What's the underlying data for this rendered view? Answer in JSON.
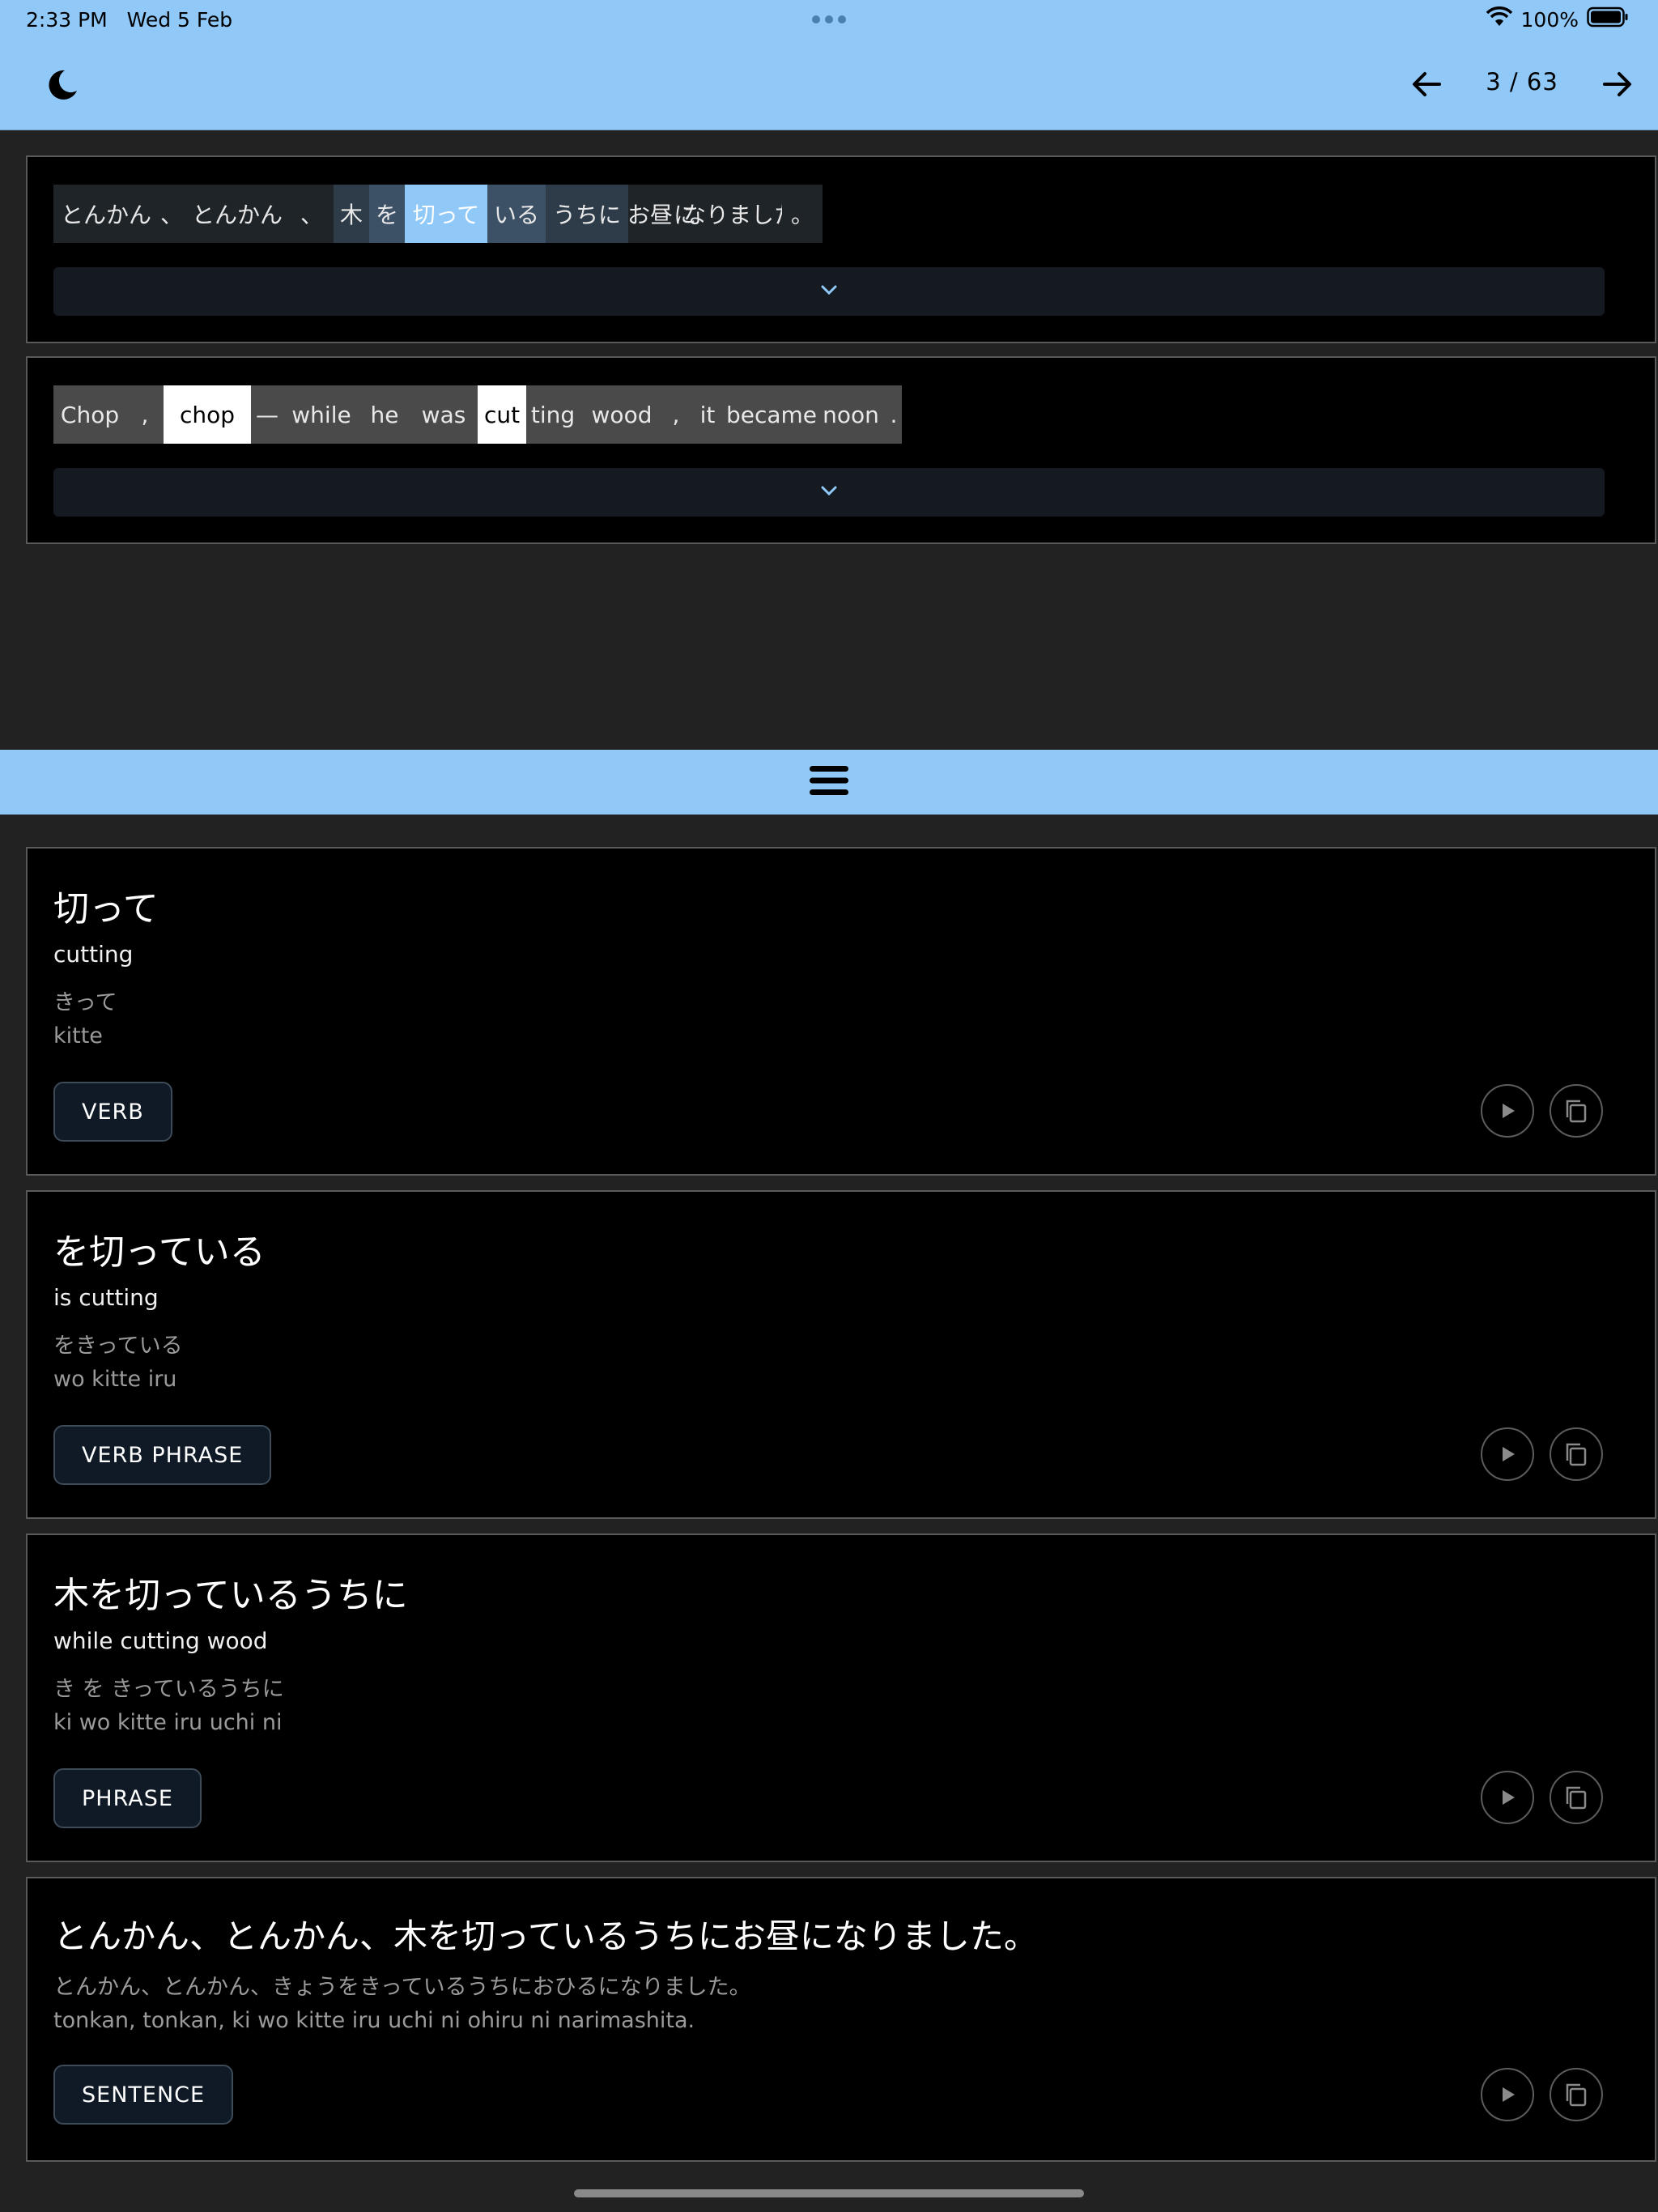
{
  "status": {
    "time": "2:33 PM",
    "date": "Wed 5 Feb",
    "battery": "100%"
  },
  "toolbar": {
    "page_indicator": "3 / 63",
    "theme_icon": "moon-icon",
    "prev_icon": "arrow-left-icon",
    "next_icon": "arrow-right-icon"
  },
  "japanese_sentence": {
    "tokens": [
      {
        "text": "とんかん",
        "bg": "#1f2429",
        "fg": "#e8e8e8"
      },
      {
        "text": "、",
        "bg": "#1f2429",
        "fg": "#e8e8e8"
      },
      {
        "text": "とんかん",
        "bg": "#1f2429",
        "fg": "#e8e8e8"
      },
      {
        "text": "、",
        "bg": "#1f2429",
        "fg": "#e8e8e8"
      },
      {
        "text": "木",
        "bg": "#2e3b48",
        "fg": "#e8e8e8"
      },
      {
        "text": "を",
        "bg": "#3d5166",
        "fg": "#e8e8e8"
      },
      {
        "text": "切って",
        "bg": "#90c8f8",
        "fg": "#ffffff"
      },
      {
        "text": "いる",
        "bg": "#3d5166",
        "fg": "#e8e8e8"
      },
      {
        "text": "うちに",
        "bg": "#2e3b48",
        "fg": "#e8e8e8"
      },
      {
        "text": "お昼",
        "bg": "#1f2429",
        "fg": "#e8e8e8"
      },
      {
        "text": "に",
        "bg": "#1f2429",
        "fg": "#e8e8e8"
      },
      {
        "text": "なりました",
        "bg": "#1f2429",
        "fg": "#e8e8e8"
      },
      {
        "text": "。",
        "bg": "#1f2429",
        "fg": "#e8e8e8"
      }
    ]
  },
  "english_sentence": {
    "tokens": [
      {
        "text": "Chop",
        "bg": "#4a4a4a",
        "fg": "#e8e8e8"
      },
      {
        "text": ",",
        "bg": "#4a4a4a",
        "fg": "#e8e8e8"
      },
      {
        "text": "chop",
        "bg": "#ffffff",
        "fg": "#000000"
      },
      {
        "text": "—",
        "bg": "#4a4a4a",
        "fg": "#e8e8e8"
      },
      {
        "text": "while",
        "bg": "#4a4a4a",
        "fg": "#e8e8e8"
      },
      {
        "text": "he",
        "bg": "#4a4a4a",
        "fg": "#e8e8e8"
      },
      {
        "text": "was",
        "bg": "#4a4a4a",
        "fg": "#e8e8e8"
      },
      {
        "text": "cut",
        "bg": "#ffffff",
        "fg": "#000000"
      },
      {
        "text": "ting",
        "bg": "#4a4a4a",
        "fg": "#e8e8e8"
      },
      {
        "text": "wood",
        "bg": "#4a4a4a",
        "fg": "#e8e8e8"
      },
      {
        "text": ",",
        "bg": "#4a4a4a",
        "fg": "#e8e8e8"
      },
      {
        "text": "it",
        "bg": "#4a4a4a",
        "fg": "#e8e8e8"
      },
      {
        "text": "became",
        "bg": "#4a4a4a",
        "fg": "#e8e8e8"
      },
      {
        "text": "noon",
        "bg": "#4a4a4a",
        "fg": "#e8e8e8"
      },
      {
        "text": ".",
        "bg": "#4a4a4a",
        "fg": "#e8e8e8"
      }
    ]
  },
  "splitter_icon": "hamburger-menu-icon",
  "cards": [
    {
      "title": "切って",
      "meaning": "cutting",
      "kana": "きって",
      "romaji": "kitte",
      "tag": "VERB"
    },
    {
      "title": "を切っている",
      "meaning": "is cutting",
      "kana": "をきっている",
      "romaji": "wo kitte iru",
      "tag": "VERB PHRASE"
    },
    {
      "title": "木を切っているうちに",
      "meaning": "while cutting wood",
      "kana": "き を きっているうちに",
      "romaji": "ki wo kitte iru uchi ni",
      "tag": "PHRASE"
    },
    {
      "title": "とんかん、とんかん、木を切っているうちにお昼になりました。",
      "kana": "とんかん、とんかん、きょうをきっているうちにおひるになりました。",
      "romaji": "tonkan, tonkan, ki wo kitte iru uchi ni ohiru ni narimashita.",
      "tag": "SENTENCE"
    }
  ],
  "colors": {
    "accent": "#90c8f8",
    "background": "#222222",
    "card": "#000000"
  }
}
